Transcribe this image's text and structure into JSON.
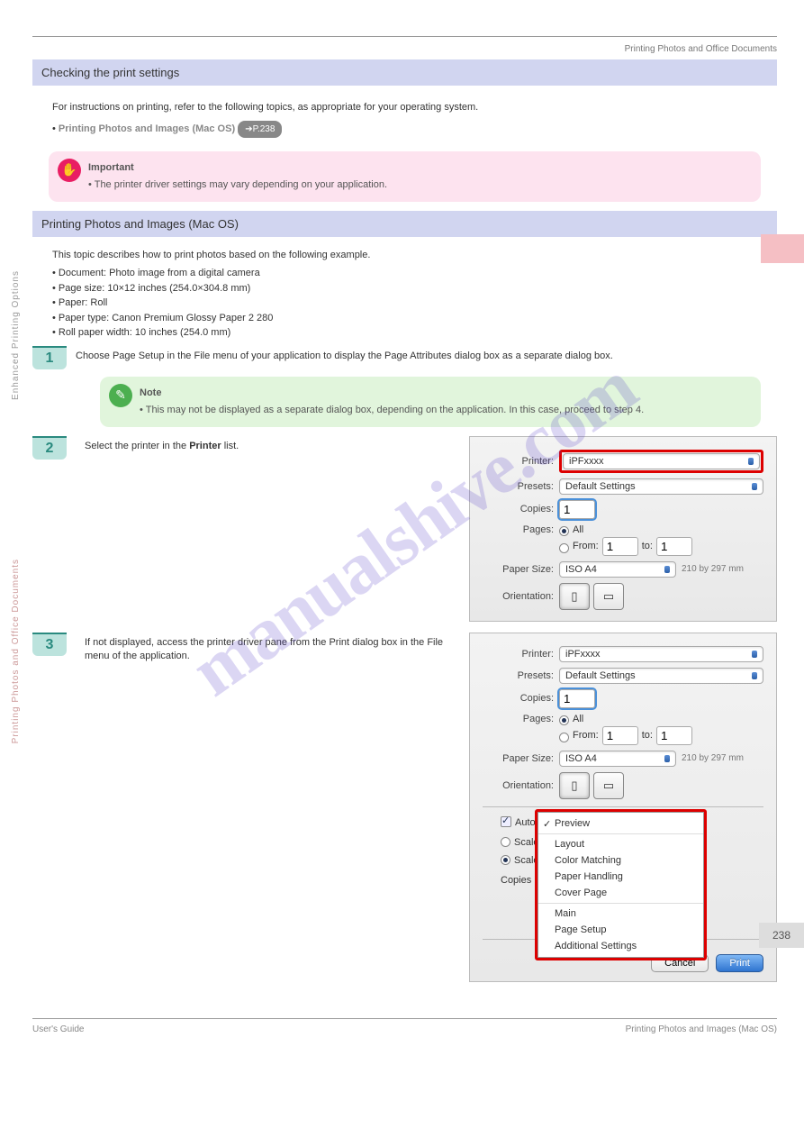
{
  "header_right": "Printing Photos and Office Documents",
  "vtext_a": "Enhanced Printing Options",
  "vtext_b": "Printing Photos and Office Documents",
  "sec1": {
    "title": "Checking the print settings",
    "p_pre": "For instructions on printing, refer to the following topics, as appropriate for your operating system.",
    "bullet1_pre": "Printing Photos and Images (Mac OS)",
    "bullet1_link": "➔P.238",
    "important_label": "Important",
    "important_text": "The printer driver settings may vary depending on your application."
  },
  "sec2": {
    "title": "Printing Photos and Images (Mac OS)",
    "intro": "This topic describes how to print photos based on the following example.",
    "ex_a": "Document: Photo image from a digital camera",
    "ex_b": "Page size: 10×12 inches (254.0×304.8 mm)",
    "ex_c": "Paper: Roll",
    "ex_d": "Paper type: Canon Premium Glossy Paper 2 280",
    "ex_e": "Roll paper width: 10 inches (254.0 mm)"
  },
  "step1": {
    "num": "1",
    "text": "Choose Page Setup in the File menu of your application to display the Page Attributes dialog box as a separate dialog box.",
    "note_label": "Note",
    "note_text": "This may not be displayed as a separate dialog box, depending on the application. In this case, proceed to step 4."
  },
  "step2": {
    "num": "2",
    "text_a": "Select the printer in the ",
    "text_b": "Printer",
    "text_c": " list."
  },
  "step3": {
    "num": "3",
    "text": "If not displayed, access the printer driver pane from the Print dialog box in the File menu of the application."
  },
  "dlg": {
    "printer_l": "Printer:",
    "printer_v": "iPFxxxx",
    "presets_l": "Presets:",
    "presets_v": "Default Settings",
    "copies_l": "Copies:",
    "copies_v": "1",
    "pages_l": "Pages:",
    "pages_all": "All",
    "pages_from": "From:",
    "pages_from_v": "1",
    "pages_to": "to:",
    "pages_to_v": "1",
    "psize_l": "Paper Size:",
    "psize_v": "ISO A4",
    "psize_hint": "210 by 297 mm",
    "orient_l": "Orientation:",
    "cb_auto": "Auto",
    "rb_scale1": "Scale",
    "rb_scale2": "Scale",
    "copies2": "Copies",
    "menu": {
      "m0": "Preview",
      "m1": "Layout",
      "m2": "Color Matching",
      "m3": "Paper Handling",
      "m4": "Cover Page",
      "m5": "Main",
      "m6": "Page Setup",
      "m7": "Additional Settings"
    },
    "cancel": "Cancel",
    "print": "Print"
  },
  "footer": {
    "left": "User's Guide",
    "right": "Printing Photos and Images (Mac OS)",
    "page": "238"
  },
  "watermark": "manualshive.com"
}
